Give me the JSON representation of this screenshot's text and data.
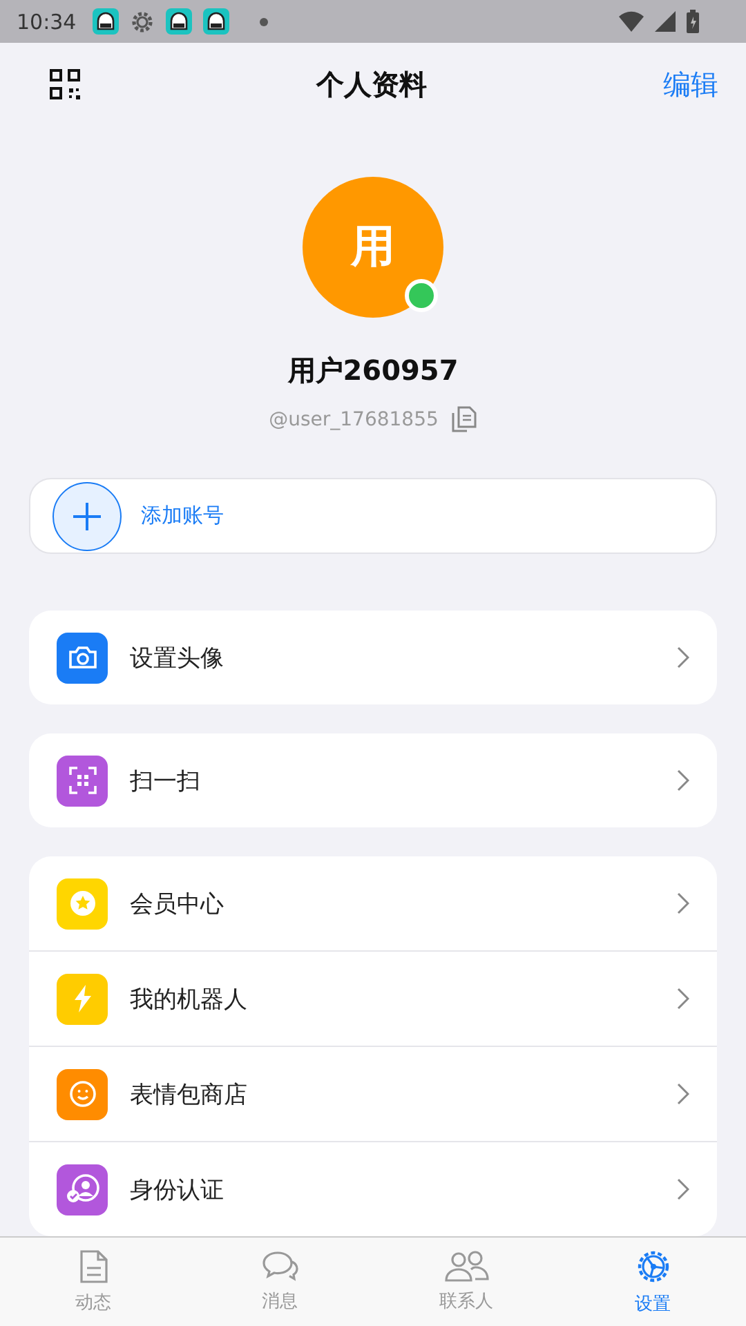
{
  "status_bar": {
    "time": "10:34"
  },
  "header": {
    "title": "个人资料",
    "action": "编辑"
  },
  "profile": {
    "avatar_text": "用",
    "online": true,
    "name": "用户260957",
    "handle": "@user_17681855"
  },
  "add_account": {
    "label": "添加账号"
  },
  "menu_groups": [
    {
      "items": [
        {
          "label": "设置头像",
          "kind": "camera",
          "color": "#1a7cf5"
        }
      ]
    },
    {
      "items": [
        {
          "label": "扫一扫",
          "kind": "scan",
          "color": "#b257dc"
        }
      ]
    },
    {
      "items": [
        {
          "label": "会员中心",
          "kind": "star",
          "color": "#ffd600"
        },
        {
          "label": "我的机器人",
          "kind": "bolt",
          "color": "#ffcc00"
        },
        {
          "label": "表情包商店",
          "kind": "smile",
          "color": "#ff8c00"
        },
        {
          "label": "身份认证",
          "kind": "id",
          "color": "#b257dc"
        }
      ]
    }
  ],
  "nav": [
    {
      "label": "动态",
      "kind": "doc",
      "selected": false
    },
    {
      "label": "消息",
      "kind": "chat",
      "selected": false
    },
    {
      "label": "联系人",
      "kind": "people",
      "selected": false
    },
    {
      "label": "设置",
      "kind": "gear",
      "selected": true
    }
  ]
}
